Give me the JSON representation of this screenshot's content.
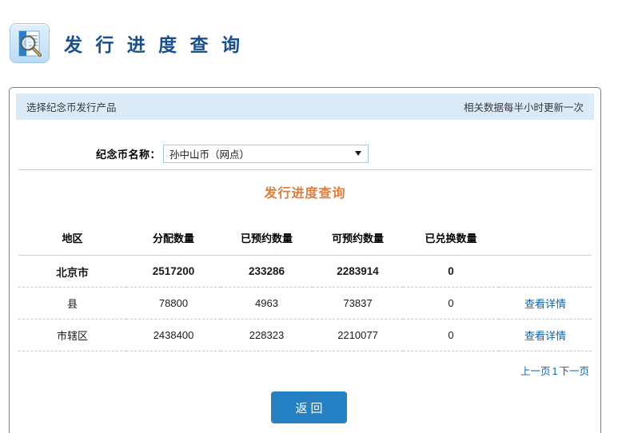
{
  "header": {
    "icon": "document-search-icon",
    "title": "发 行 进 度 查 询"
  },
  "panel_bar": {
    "left_text": "选择纪念币发行产品",
    "right_text": "相关数据每半小时更新一次"
  },
  "form": {
    "coin_label": "纪念币名称：",
    "coin_selected": "孙中山币（网点）",
    "caret_icon": "chevron-down-icon"
  },
  "section": {
    "title": "发行进度查询"
  },
  "table": {
    "columns": [
      "地区",
      "分配数量",
      "已预约数量",
      "可预约数量",
      "已兑换数量",
      ""
    ],
    "rows": [
      {
        "region": "北京市",
        "allocated": "2517200",
        "booked": "233286",
        "available": "2283914",
        "redeemed": "0",
        "detail": "",
        "is_total": true
      },
      {
        "region": "县",
        "allocated": "78800",
        "booked": "4963",
        "available": "73837",
        "redeemed": "0",
        "detail": "查看详情",
        "is_total": false
      },
      {
        "region": "市辖区",
        "allocated": "2438400",
        "booked": "228323",
        "available": "2210077",
        "redeemed": "0",
        "detail": "查看详情",
        "is_total": false
      }
    ]
  },
  "pagination": {
    "prev": "上一页",
    "current": "1",
    "next": "下一页"
  },
  "footer": {
    "back_label": "返回"
  },
  "colors": {
    "panel_border": "#3a8fd0",
    "panel_bar_bg": "#dbeaf7",
    "title_blue": "#1b4f8c",
    "section_orange": "#e07c3a",
    "link_blue": "#0d64ad",
    "button_blue": "#2580c4"
  }
}
